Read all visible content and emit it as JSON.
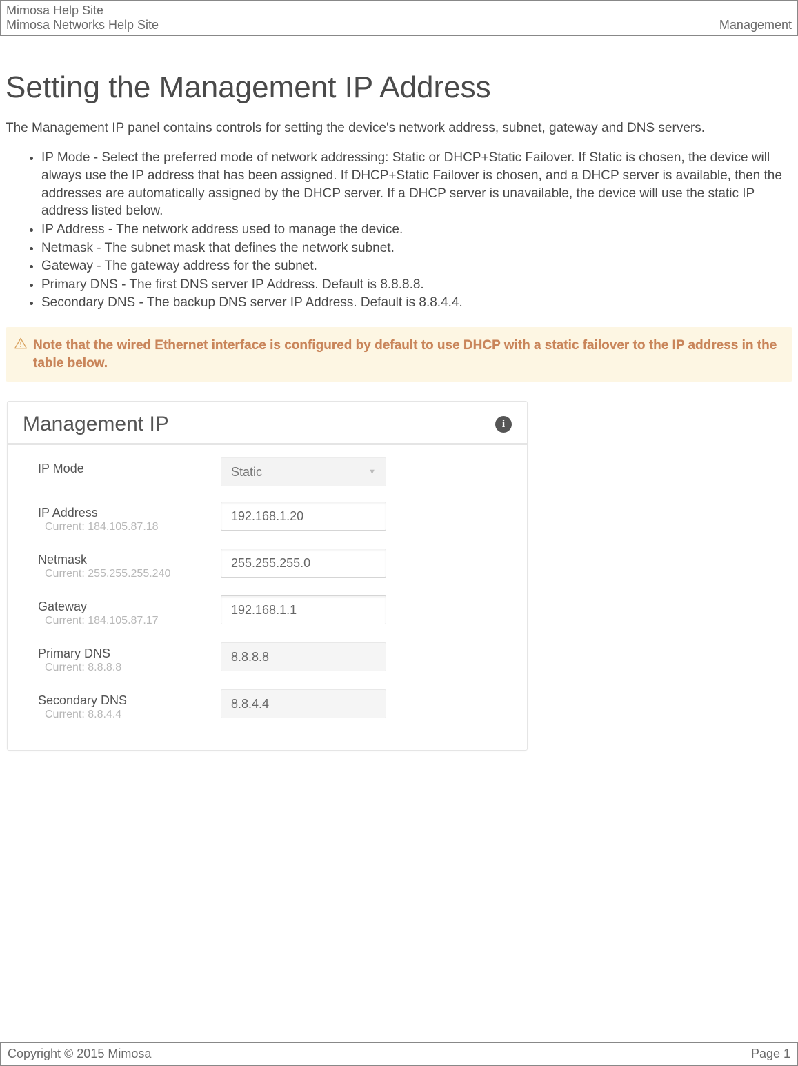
{
  "header": {
    "site_line1": "Mimosa Help Site",
    "site_line2": "Mimosa Networks Help Site",
    "section": "Management"
  },
  "page": {
    "title": "Setting the Management IP Address",
    "intro": "The Management IP panel contains controls for setting the device's network address, subnet, gateway and DNS servers."
  },
  "definitions": [
    "IP Mode - Select the preferred mode of network addressing: Static or DHCP+Static Failover. If Static is chosen, the device will always use the IP address that has been assigned. If DHCP+Static Failover is chosen, and a DHCP server is available, then the addresses are automatically assigned by the DHCP server. If a DHCP server is unavailable, the device will use the static IP address listed below.",
    "IP Address - The network address used to manage the device.",
    "Netmask - The subnet mask that defines the network subnet.",
    "Gateway - The gateway address for the subnet.",
    "Primary DNS - The first DNS server IP Address. Default is 8.8.8.8.",
    "Secondary DNS - The backup DNS server IP Address. Default is 8.8.4.4."
  ],
  "note": "Note that the wired Ethernet interface is configured by default to use DHCP with a static failover to the IP address in the table below.",
  "panel": {
    "title": "Management IP",
    "info_glyph": "i",
    "rows": {
      "ip_mode": {
        "label": "IP Mode",
        "current": "",
        "value": "Static",
        "type": "select"
      },
      "ip_address": {
        "label": "IP Address",
        "current": "Current: 184.105.87.18",
        "value": "192.168.1.20",
        "type": "input"
      },
      "netmask": {
        "label": "Netmask",
        "current": "Current: 255.255.255.240",
        "value": "255.255.255.0",
        "type": "input"
      },
      "gateway": {
        "label": "Gateway",
        "current": "Current: 184.105.87.17",
        "value": "192.168.1.1",
        "type": "input"
      },
      "primary_dns": {
        "label": "Primary DNS",
        "current": "Current: 8.8.8.8",
        "value": "8.8.8.8",
        "type": "flat"
      },
      "secondary_dns": {
        "label": "Secondary DNS",
        "current": "Current: 8.8.4.4",
        "value": "8.8.4.4",
        "type": "flat"
      }
    }
  },
  "footer": {
    "copyright": "Copyright © 2015 Mimosa",
    "page": "Page 1"
  }
}
